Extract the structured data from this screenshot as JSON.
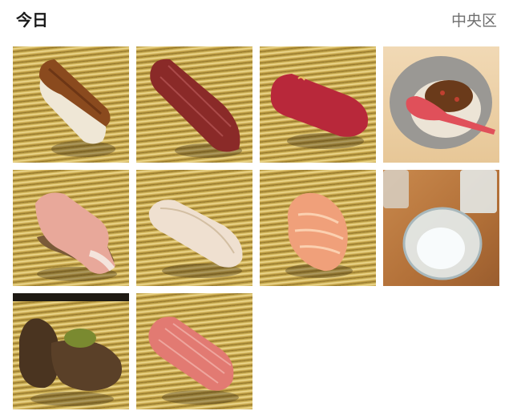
{
  "header": {
    "title": "今日",
    "location": "中央区"
  },
  "photos": [
    {
      "name": "photo-eel-nigiri",
      "colors": {
        "fish": "#8a4a1e",
        "top": "#5a2a10"
      }
    },
    {
      "name": "photo-tuna-nigiri",
      "colors": {
        "fish": "#8a2a28"
      }
    },
    {
      "name": "photo-akami-nigiri",
      "colors": {
        "fish": "#b8283a"
      }
    },
    {
      "name": "photo-bowl-with-spoon",
      "colors": {
        "bowl": "#9a9894",
        "spoon": "#e0505a"
      }
    },
    {
      "name": "photo-kanpachi-nigiri",
      "colors": {
        "fish": "#e8a89a"
      }
    },
    {
      "name": "photo-whitefish-nigiri",
      "colors": {
        "fish": "#efe0d0"
      }
    },
    {
      "name": "photo-ebi-nigiri",
      "colors": {
        "fish": "#f0a07a"
      }
    },
    {
      "name": "photo-sake-glasses",
      "colors": {
        "glass": "#e6eef0"
      }
    },
    {
      "name": "photo-awabi-abalone",
      "colors": {
        "fish": "#4a3420"
      }
    },
    {
      "name": "photo-toro-nigiri",
      "colors": {
        "fish": "#e27a72"
      }
    }
  ]
}
